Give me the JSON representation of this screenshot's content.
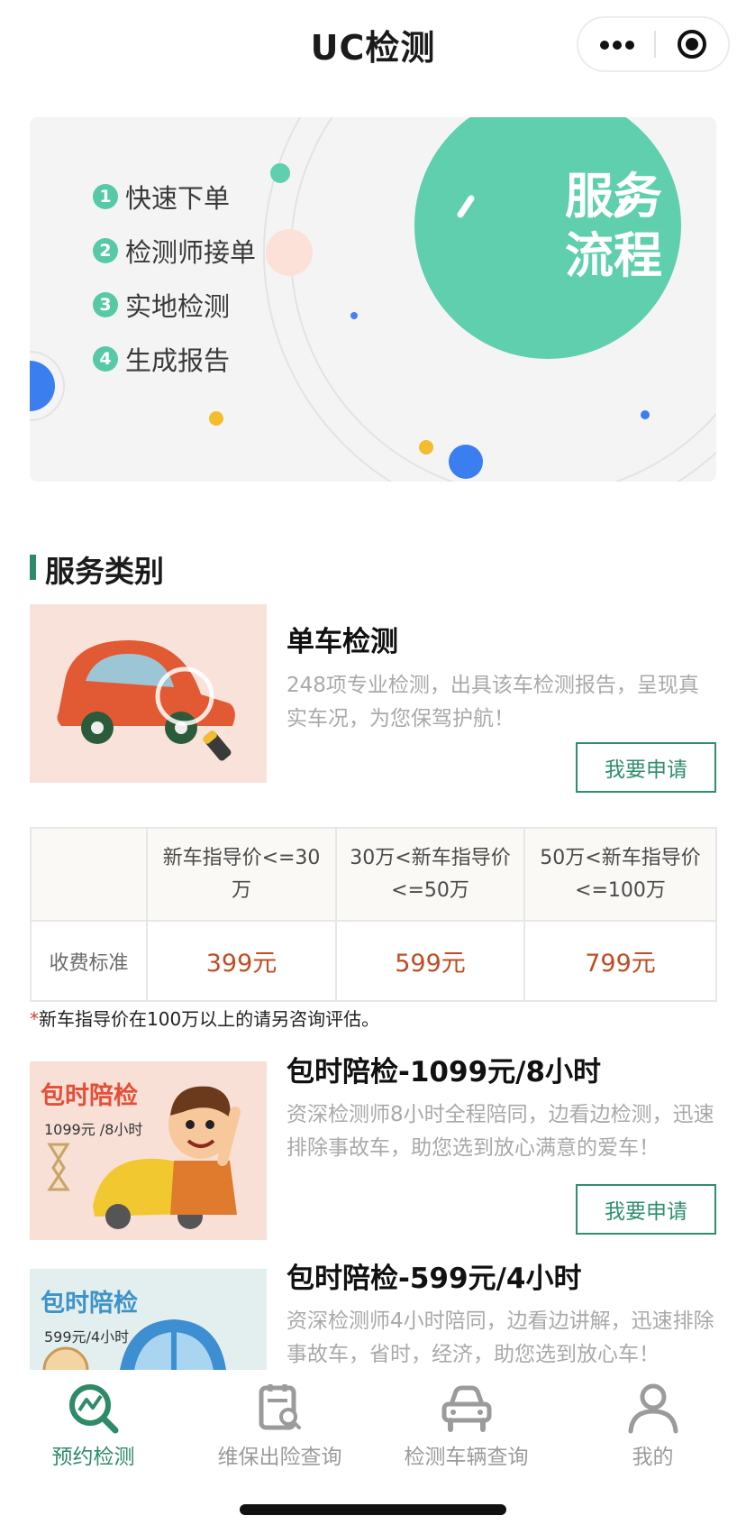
{
  "header": {
    "title": "UC检测"
  },
  "banner": {
    "title_line1": "服务",
    "title_line2": "流程",
    "steps": [
      {
        "num": "1",
        "label": "快速下单"
      },
      {
        "num": "2",
        "label": "检测师接单"
      },
      {
        "num": "3",
        "label": "实地检测"
      },
      {
        "num": "4",
        "label": "生成报告"
      }
    ]
  },
  "section": {
    "title": "服务类别"
  },
  "services": [
    {
      "title": "单车检测",
      "desc": "248项专业检测，出具该车检测报告，呈现真实车况，为您保驾护航！",
      "button": "我要申请"
    },
    {
      "title": "包时陪检-1099元/8小时",
      "desc": "资深检测师8小时全程陪同，边看边检测，迅速排除事故车，助您选到放心满意的爱车！",
      "button": "我要申请",
      "image_title": "包时陪检",
      "image_sub": "1099元 /8小时"
    },
    {
      "title": "包时陪检-599元/4小时",
      "desc": "资深检测师4小时陪同，边看边讲解，迅速排除事故车，省时，经济，助您选到放心车！",
      "image_title": "包时陪检",
      "image_sub": "599元/4小时"
    }
  ],
  "price_table": {
    "headers": [
      "新车指导价<=30万",
      "30万<新车指导价<=50万",
      "50万<新车指导价<=100万"
    ],
    "row_label": "收费标准",
    "prices": [
      "399元",
      "599元",
      "799元"
    ]
  },
  "note": {
    "star": "*",
    "text": "新车指导价在100万以上的请另咨询评估。"
  },
  "tabbar": {
    "items": [
      {
        "label": "预约检测",
        "active": true
      },
      {
        "label": "维保出险查询",
        "active": false
      },
      {
        "label": "检测车辆查询",
        "active": false
      },
      {
        "label": "我的",
        "active": false
      }
    ]
  },
  "colors": {
    "accent": "#2f8e6c",
    "price": "#c14c24",
    "teal": "#5fcfae",
    "inactive": "#9b9b9b"
  }
}
